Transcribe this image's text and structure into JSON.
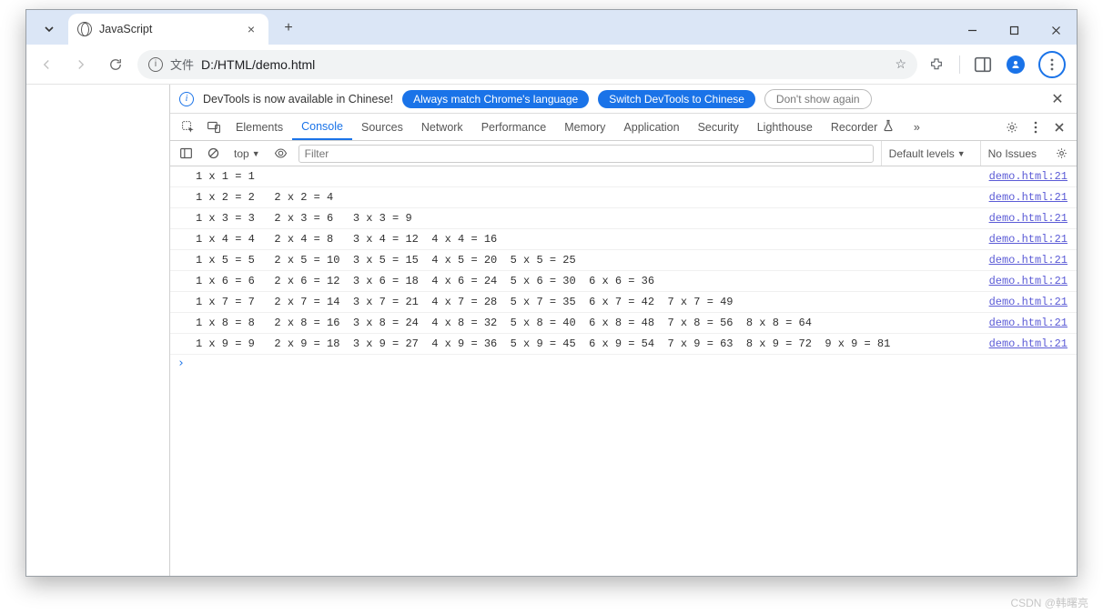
{
  "browser": {
    "tab_title": "JavaScript",
    "new_tab": "+",
    "close_tab": "×",
    "window": {
      "min": "—",
      "max": "□",
      "close": "×"
    },
    "url_scheme": "文件",
    "url_path": "D:/HTML/demo.html"
  },
  "devtools": {
    "infobar": {
      "text": "DevTools is now available in Chinese!",
      "btn_match": "Always match Chrome's language",
      "btn_switch": "Switch DevTools to Chinese",
      "btn_dismiss": "Don't show again"
    },
    "tabs": [
      "Elements",
      "Console",
      "Sources",
      "Network",
      "Performance",
      "Memory",
      "Application",
      "Security",
      "Lighthouse",
      "Recorder"
    ],
    "active_tab": "Console",
    "more": "»",
    "toolbar": {
      "context": "top",
      "filter_placeholder": "Filter",
      "levels": "Default levels",
      "issues": "No Issues"
    },
    "logs": [
      {
        "msg": "1 x 1 = 1",
        "src": "demo.html:21"
      },
      {
        "msg": "1 x 2 = 2   2 x 2 = 4",
        "src": "demo.html:21"
      },
      {
        "msg": "1 x 3 = 3   2 x 3 = 6   3 x 3 = 9",
        "src": "demo.html:21"
      },
      {
        "msg": "1 x 4 = 4   2 x 4 = 8   3 x 4 = 12  4 x 4 = 16",
        "src": "demo.html:21"
      },
      {
        "msg": "1 x 5 = 5   2 x 5 = 10  3 x 5 = 15  4 x 5 = 20  5 x 5 = 25",
        "src": "demo.html:21"
      },
      {
        "msg": "1 x 6 = 6   2 x 6 = 12  3 x 6 = 18  4 x 6 = 24  5 x 6 = 30  6 x 6 = 36",
        "src": "demo.html:21"
      },
      {
        "msg": "1 x 7 = 7   2 x 7 = 14  3 x 7 = 21  4 x 7 = 28  5 x 7 = 35  6 x 7 = 42  7 x 7 = 49",
        "src": "demo.html:21"
      },
      {
        "msg": "1 x 8 = 8   2 x 8 = 16  3 x 8 = 24  4 x 8 = 32  5 x 8 = 40  6 x 8 = 48  7 x 8 = 56  8 x 8 = 64",
        "src": "demo.html:21"
      },
      {
        "msg": "1 x 9 = 9   2 x 9 = 18  3 x 9 = 27  4 x 9 = 36  5 x 9 = 45  6 x 9 = 54  7 x 9 = 63  8 x 9 = 72  9 x 9 = 81",
        "src": "demo.html:21"
      }
    ],
    "prompt": "›"
  },
  "watermark": "CSDN @韩曙亮"
}
